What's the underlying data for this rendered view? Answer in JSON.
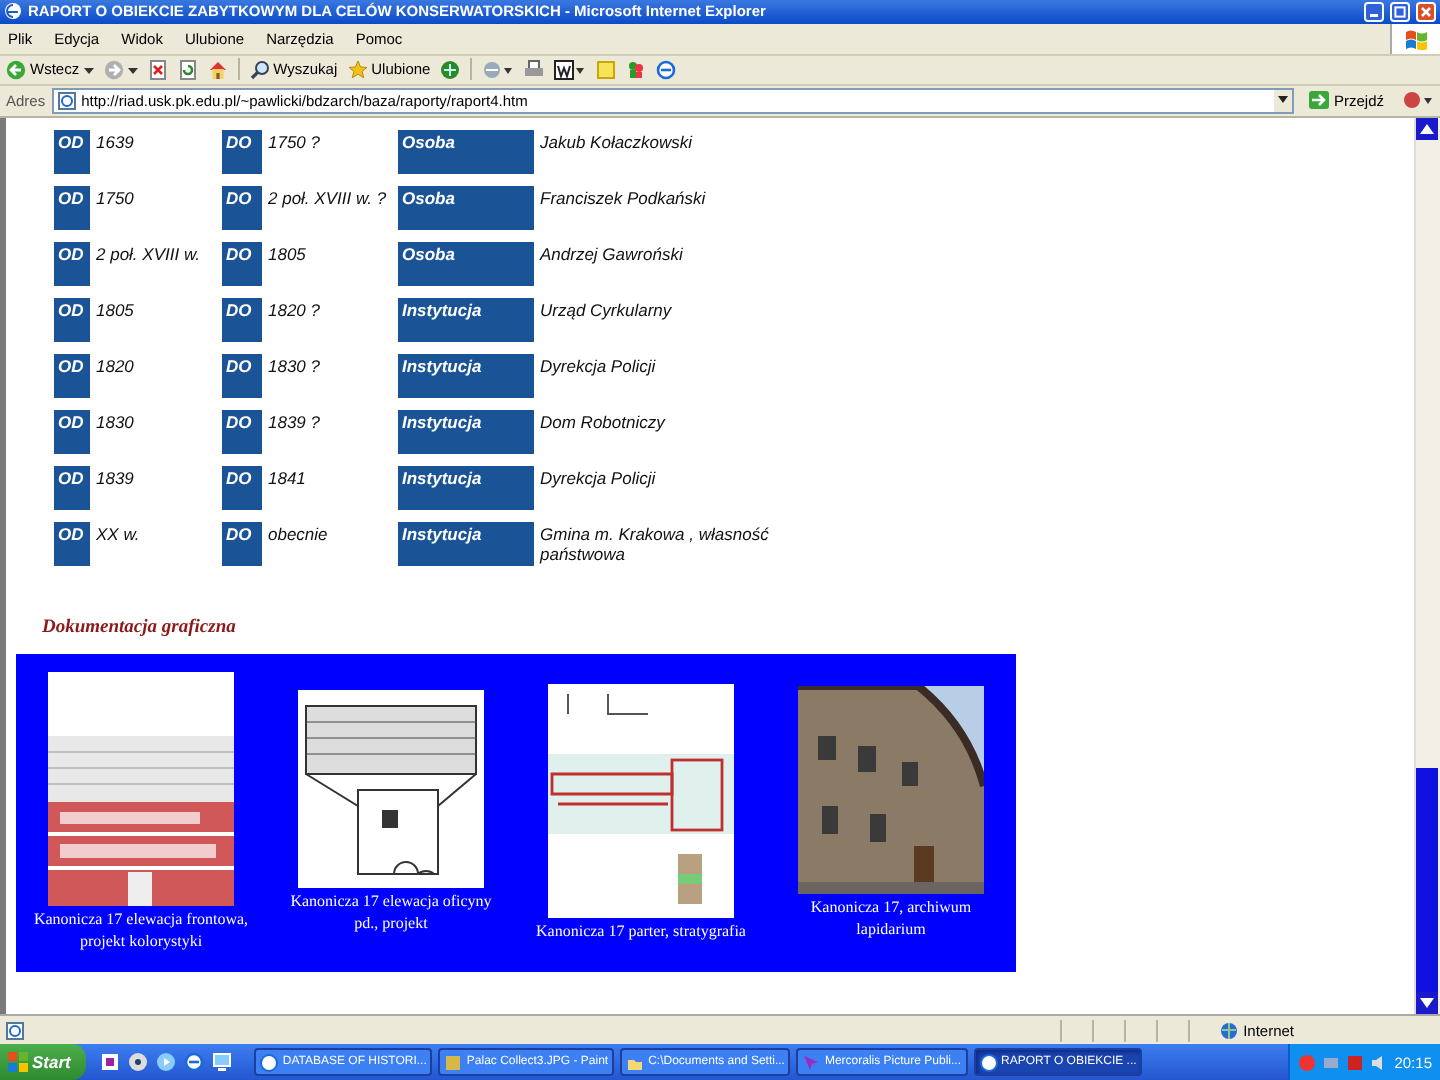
{
  "window": {
    "title": "RAPORT O OBIEKCIE ZABYTKOWYM DLA CELÓW KONSERWATORSKICH - Microsoft Internet Explorer"
  },
  "menu": [
    "Plik",
    "Edycja",
    "Widok",
    "Ulubione",
    "Narzędzia",
    "Pomoc"
  ],
  "toolbar": {
    "back": "Wstecz",
    "search": "Wyszukaj",
    "favorites": "Ulubione"
  },
  "address_bar": {
    "label": "Adres",
    "value": "http://riad.usk.pk.edu.pl/~pawlicki/bdzarch/baza/raporty/raport4.htm",
    "go": "Przejdź"
  },
  "records": [
    {
      "from_label": "OD",
      "from": "1639",
      "to_label": "DO",
      "to": "1750 ?",
      "type": "Osoba",
      "name": "Jakub Kołaczkowski"
    },
    {
      "from_label": "OD",
      "from": "1750",
      "to_label": "DO",
      "to": "2 poł. XVIII w. ?",
      "type": "Osoba",
      "name": "Franciszek Podkański"
    },
    {
      "from_label": "OD",
      "from": "2 poł. XVIII w.",
      "to_label": "DO",
      "to": "1805",
      "type": "Osoba",
      "name": "Andrzej Gawroński"
    },
    {
      "from_label": "OD",
      "from": "1805",
      "to_label": "DO",
      "to": "1820 ?",
      "type": "Instytucja",
      "name": "Urząd Cyrkularny"
    },
    {
      "from_label": "OD",
      "from": "1820",
      "to_label": "DO",
      "to": "1830 ?",
      "type": "Instytucja",
      "name": "Dyrekcja Policji"
    },
    {
      "from_label": "OD",
      "from": "1830",
      "to_label": "DO",
      "to": "1839 ?",
      "type": "Instytucja",
      "name": "Dom Robotniczy"
    },
    {
      "from_label": "OD",
      "from": "1839",
      "to_label": "DO",
      "to": "1841",
      "type": "Instytucja",
      "name": "Dyrekcja Policji"
    },
    {
      "from_label": "OD",
      "from": "XX w.",
      "to_label": "DO",
      "to": "obecnie",
      "type": "Instytucja",
      "name": "Gmina m. Krakowa , własność państwowa"
    }
  ],
  "section_heading": "Dokumentacja graficzna",
  "gallery": [
    {
      "caption": "Kanonicza 17 elewacja frontowa, projekt kolorystyki"
    },
    {
      "caption": "Kanonicza 17 elewacja oficyny pd., projekt"
    },
    {
      "caption": "Kanonicza 17 parter, stratygrafia"
    },
    {
      "caption": "Kanonicza 17, archiwum lapidarium"
    }
  ],
  "status_bar": {
    "zone": "Internet"
  },
  "taskbar": {
    "start": "Start",
    "tasks": [
      {
        "label": "DATABASE OF HISTORI...",
        "selected": false
      },
      {
        "label": "Palac Collect3.JPG - Paint",
        "selected": false
      },
      {
        "label": "C:\\Documents and Setti...",
        "selected": false
      },
      {
        "label": "Mercoralis Picture Publi...",
        "selected": false
      },
      {
        "label": "RAPORT O OBIEKCIE ...",
        "selected": true
      }
    ],
    "clock": "20:15"
  }
}
